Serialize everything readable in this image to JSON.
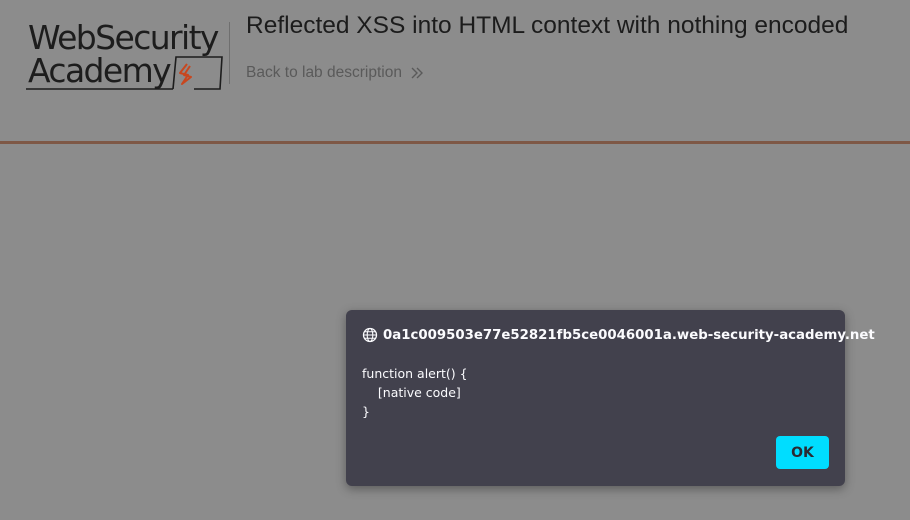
{
  "header": {
    "logo": {
      "line1": "WebSecurity",
      "line2": "Academy",
      "accent_color": "#c8471f"
    },
    "lab_title": "Reflected XSS into HTML context with nothing encoded",
    "back_link_label": "Back to lab description",
    "back_link_icon": "double-chevron-right-icon"
  },
  "dialog": {
    "origin_icon": "globe-icon",
    "origin": "0a1c009503e77e52821fb5ce0046001a.web-security-academy.net",
    "message": "function alert() {\n    [native code]\n}",
    "ok_label": "OK",
    "ok_color": "#00ddff"
  }
}
